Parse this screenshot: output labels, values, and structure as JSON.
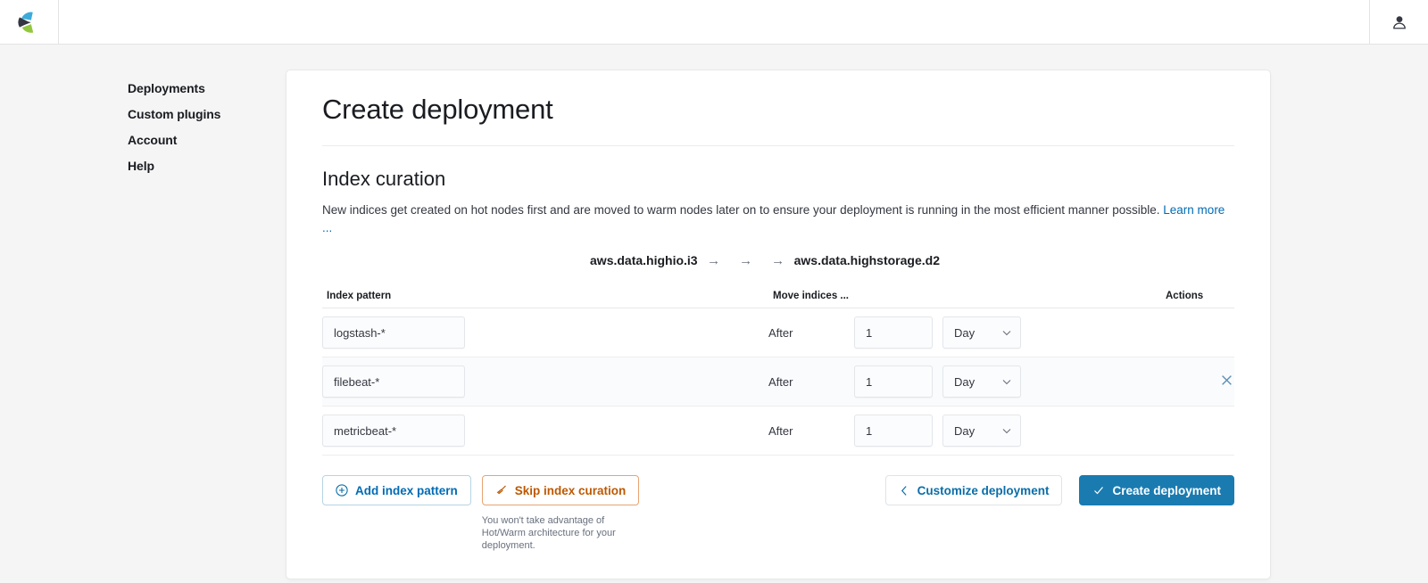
{
  "topbar": {
    "logo_name": "elastic-logo",
    "user_icon": "user-icon"
  },
  "sidebar": {
    "items": [
      {
        "label": "Deployments"
      },
      {
        "label": "Custom plugins"
      },
      {
        "label": "Account"
      },
      {
        "label": "Help"
      }
    ]
  },
  "panel": {
    "title": "Create deployment",
    "section_title": "Index curation",
    "description": "New indices get created on hot nodes first and are moved to warm nodes later on to ensure your deployment is running in the most efficient manner possible. ",
    "learn_more": "Learn more ...",
    "node_flow": {
      "source": "aws.data.highio.i3",
      "target": "aws.data.highstorage.d2",
      "arrow": "→",
      "arrow_count": 3
    },
    "table": {
      "headers": {
        "pattern": "Index pattern",
        "move": "Move indices ...",
        "actions": "Actions"
      },
      "rows": [
        {
          "pattern": "logstash-*",
          "after_label": "After",
          "amount": "1",
          "unit": "Day",
          "highlight": false,
          "has_delete": false
        },
        {
          "pattern": "filebeat-*",
          "after_label": "After",
          "amount": "1",
          "unit": "Day",
          "highlight": true,
          "has_delete": true
        },
        {
          "pattern": "metricbeat-*",
          "after_label": "After",
          "amount": "1",
          "unit": "Day",
          "highlight": false,
          "has_delete": false
        }
      ]
    },
    "footer": {
      "add_pattern_label": "Add index pattern",
      "skip_label": "Skip index curation",
      "skip_note": "You won't take advantage of Hot/Warm architecture for your deployment.",
      "customize_label": "Customize deployment",
      "create_label": "Create deployment"
    }
  },
  "colors": {
    "link": "#006bb4",
    "primary_button": "#1a7bb0",
    "orange_accent": "#bd5800",
    "page_background": "#f5f5f5"
  }
}
